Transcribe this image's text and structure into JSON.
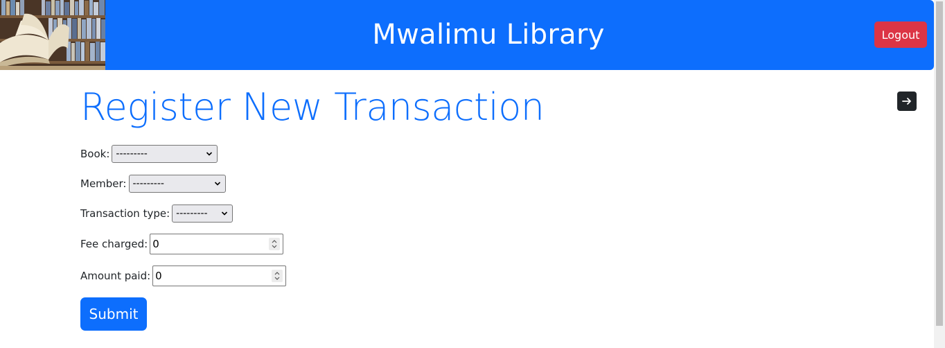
{
  "header": {
    "brand": "Mwalimu Library",
    "logout_label": "Logout",
    "bg_color": "#0d6efd",
    "logout_color": "#dc3545",
    "logo_image": "books-logo"
  },
  "page": {
    "title": "Register New Transaction",
    "title_color": "#0d6efd",
    "nav_icon": "arrow-right-icon"
  },
  "form": {
    "book": {
      "label": "Book:",
      "selected": "---------"
    },
    "member": {
      "label": "Member:",
      "selected": "---------"
    },
    "transaction_type": {
      "label": "Transaction type:",
      "selected": "---------"
    },
    "fee_charged": {
      "label": "Fee charged:",
      "value": "0"
    },
    "amount_paid": {
      "label": "Amount paid:",
      "value": "0"
    },
    "submit_label": "Submit"
  }
}
